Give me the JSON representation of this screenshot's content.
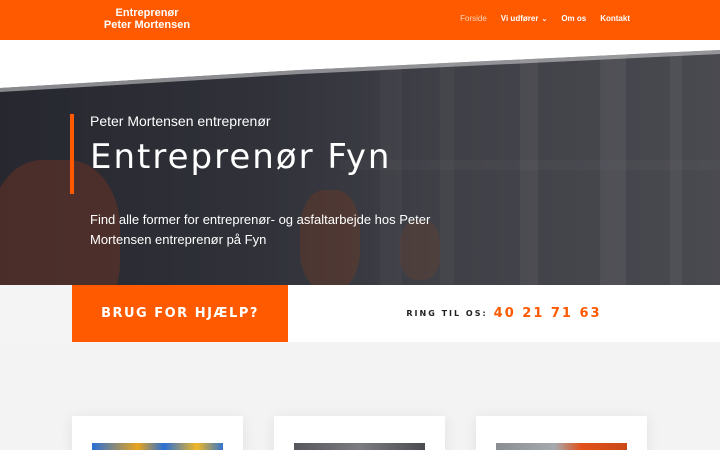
{
  "header": {
    "logo_line1": "Entreprenør",
    "logo_line2": "Peter Mortensen",
    "nav": [
      {
        "label": "Forside",
        "active": true
      },
      {
        "label": "Vi udfører",
        "has_dropdown": true
      },
      {
        "label": "Om os"
      },
      {
        "label": "Kontakt"
      }
    ]
  },
  "hero": {
    "subtitle": "Peter Mortensen entreprenør",
    "title": "Entreprenør Fyn",
    "text": "Find alle former for entreprenør- og asfaltarbejde hos Peter Mortensen entreprenør på Fyn"
  },
  "cta": {
    "button_label": "BRUG FOR HJÆLP?",
    "ring_label": "RING TIL OS:",
    "phone": "40 21 71 63"
  },
  "colors": {
    "brand": "#ff5a00",
    "dark": "#2d2f36"
  }
}
